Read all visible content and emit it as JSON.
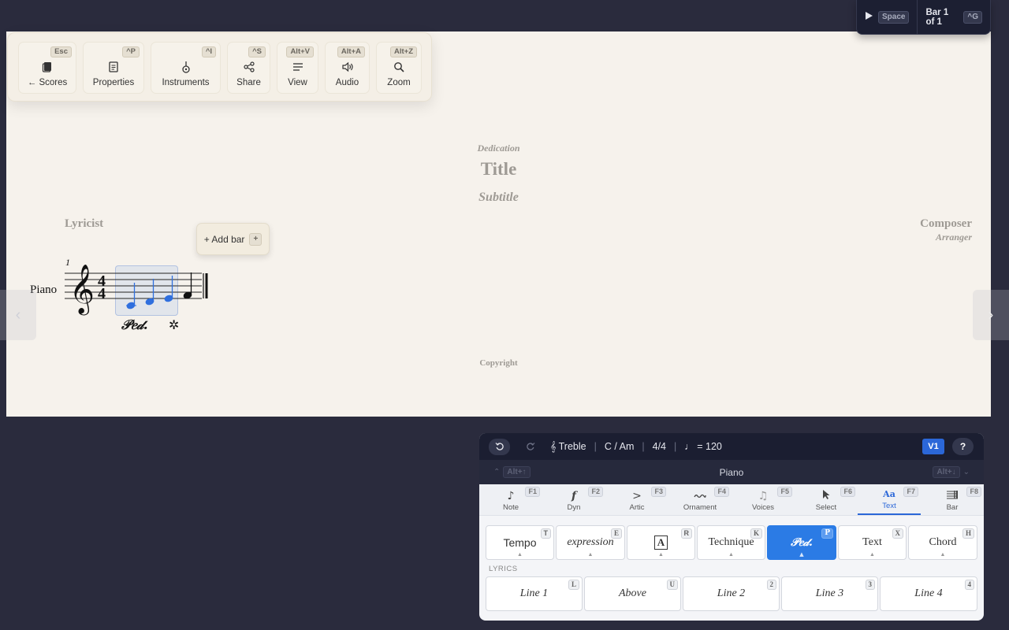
{
  "toolbar": {
    "scores": {
      "label": "← Scores",
      "key": "Esc",
      "icon": "book-icon"
    },
    "properties": {
      "label": "Properties",
      "key": "^P",
      "icon": "document-icon"
    },
    "instruments": {
      "label": "Instruments",
      "key": "^I",
      "icon": "instrument-icon"
    },
    "share": {
      "label": "Share",
      "key": "^S",
      "icon": "share-icon"
    },
    "view": {
      "label": "View",
      "key": "Alt+V",
      "icon": "lines-icon"
    },
    "audio": {
      "label": "Audio",
      "key": "Alt+A",
      "icon": "speaker-icon"
    },
    "zoom": {
      "label": "Zoom",
      "key": "Alt+Z",
      "icon": "magnifier-icon"
    }
  },
  "transport": {
    "play_key": "Space",
    "bar_text": "Bar 1 of 1",
    "goto_key": "^G"
  },
  "score": {
    "dedication": "Dedication",
    "title": "Title",
    "subtitle": "Subtitle",
    "lyricist": "Lyricist",
    "composer": "Composer",
    "arranger": "Arranger",
    "copyright": "Copyright",
    "instrument": "Piano",
    "bar_number": "1",
    "time_signature": "4/4",
    "add_bar_label": "+ Add bar",
    "add_bar_key": "+",
    "pedal_start": "𝒫𝑒𝒹.",
    "pedal_end": "✲",
    "colors": {
      "selected_note": "#2f6fde",
      "page": "#f6f2ec"
    }
  },
  "palette": {
    "status": {
      "clef": "𝄞 Treble",
      "key": "C / Am",
      "time": "4/4",
      "tempo": "♩ = 120",
      "voice": "V1",
      "help": "?"
    },
    "instrument": {
      "name": "Piano",
      "prev_key": "Alt+↑",
      "next_key": "Alt+↓"
    },
    "tabs": [
      {
        "label": "Note",
        "key": "F1",
        "icon": "♪"
      },
      {
        "label": "Dyn",
        "key": "F2",
        "icon": "𝆑"
      },
      {
        "label": "Artic",
        "key": "F3",
        "icon": ">"
      },
      {
        "label": "Ornament",
        "key": "F4",
        "icon": "〰"
      },
      {
        "label": "Voices",
        "key": "F5",
        "icon": "♫"
      },
      {
        "label": "Select",
        "key": "F6",
        "icon": "➤"
      },
      {
        "label": "Text",
        "key": "F7",
        "icon": "Aa"
      },
      {
        "label": "Bar",
        "key": "F8",
        "icon": "☰"
      }
    ],
    "text_buttons": [
      {
        "label": "Tempo",
        "key": "T"
      },
      {
        "label": "expression",
        "key": "E"
      },
      {
        "label": "A",
        "key": "R"
      },
      {
        "label": "Technique",
        "key": "K"
      },
      {
        "label": "𝒫𝑒𝒹.",
        "key": "P"
      },
      {
        "label": "Text",
        "key": "X"
      },
      {
        "label": "Chord",
        "key": "H"
      }
    ],
    "lyrics_label": "LYRICS",
    "lyric_buttons": [
      {
        "label": "Line 1",
        "key": "L"
      },
      {
        "label": "Above",
        "key": "U"
      },
      {
        "label": "Line 2",
        "key": "2"
      },
      {
        "label": "Line 3",
        "key": "3"
      },
      {
        "label": "Line 4",
        "key": "4"
      }
    ],
    "accent": "#2b7be5"
  }
}
